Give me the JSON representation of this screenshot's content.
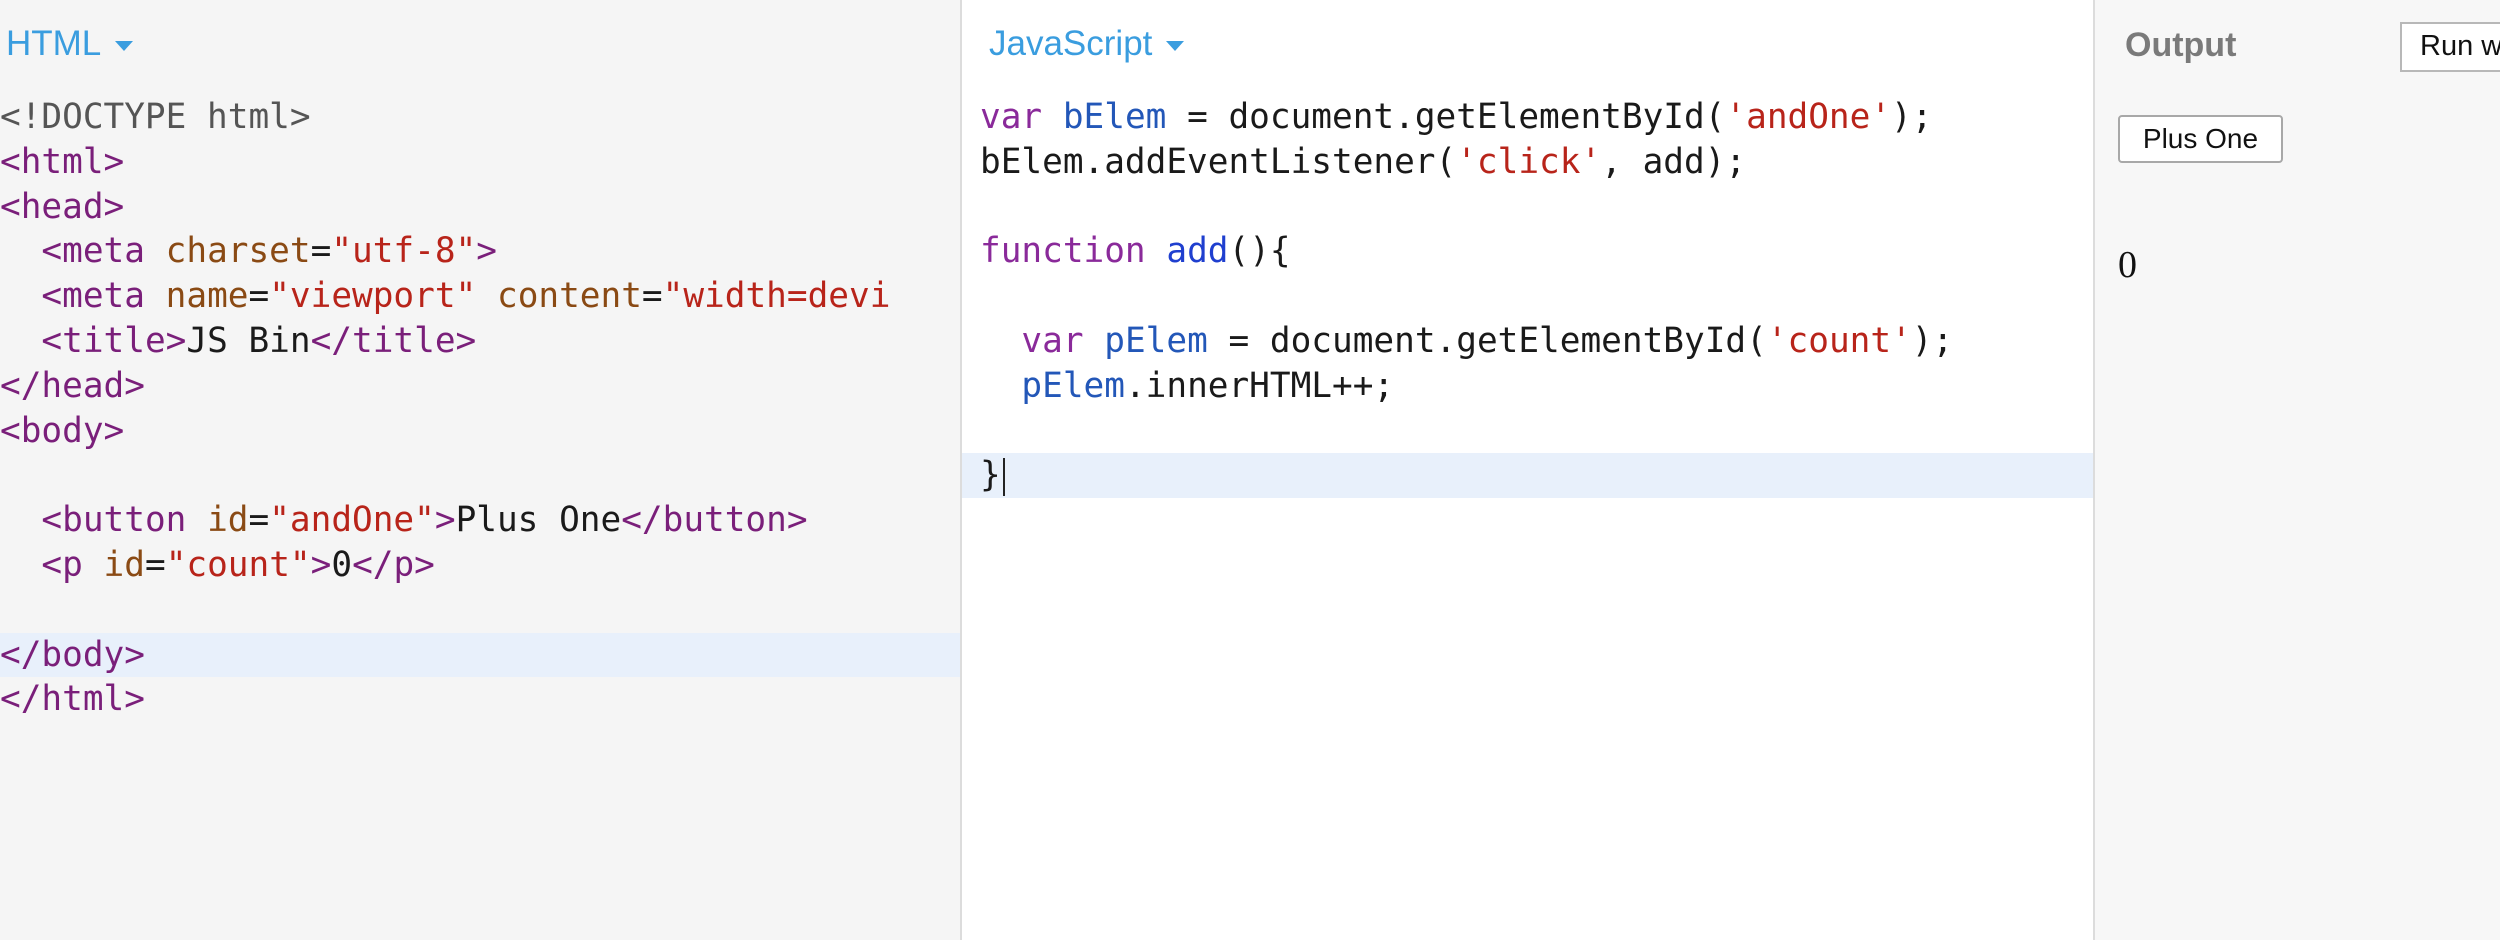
{
  "html_panel": {
    "label": "HTML",
    "lines": [
      [
        {
          "t": "doctype",
          "v": "<!DOCTYPE html>"
        }
      ],
      [
        {
          "t": "tag",
          "v": "<html>"
        }
      ],
      [
        {
          "t": "tag",
          "v": "<head>"
        }
      ],
      [
        {
          "t": "text",
          "v": "  "
        },
        {
          "t": "tag",
          "v": "<meta "
        },
        {
          "t": "attr",
          "v": "charset"
        },
        {
          "t": "text",
          "v": "="
        },
        {
          "t": "str",
          "v": "\"utf-8\""
        },
        {
          "t": "tag",
          "v": ">"
        }
      ],
      [
        {
          "t": "text",
          "v": "  "
        },
        {
          "t": "tag",
          "v": "<meta "
        },
        {
          "t": "attr",
          "v": "name"
        },
        {
          "t": "text",
          "v": "="
        },
        {
          "t": "str",
          "v": "\"viewport\""
        },
        {
          "t": "text",
          "v": " "
        },
        {
          "t": "attr",
          "v": "content"
        },
        {
          "t": "text",
          "v": "="
        },
        {
          "t": "str",
          "v": "\"width=devi"
        }
      ],
      [
        {
          "t": "text",
          "v": "  "
        },
        {
          "t": "tag",
          "v": "<title>"
        },
        {
          "t": "text",
          "v": "JS Bin"
        },
        {
          "t": "tag",
          "v": "</title>"
        }
      ],
      [
        {
          "t": "tag",
          "v": "</head>"
        }
      ],
      [
        {
          "t": "tag",
          "v": "<body>"
        }
      ],
      [],
      [
        {
          "t": "text",
          "v": "  "
        },
        {
          "t": "tag",
          "v": "<button "
        },
        {
          "t": "attr",
          "v": "id"
        },
        {
          "t": "text",
          "v": "="
        },
        {
          "t": "str",
          "v": "\"andOne\""
        },
        {
          "t": "tag",
          "v": ">"
        },
        {
          "t": "text",
          "v": "Plus One"
        },
        {
          "t": "tag",
          "v": "</button>"
        }
      ],
      [
        {
          "t": "text",
          "v": "  "
        },
        {
          "t": "tag",
          "v": "<p "
        },
        {
          "t": "attr",
          "v": "id"
        },
        {
          "t": "text",
          "v": "="
        },
        {
          "t": "str",
          "v": "\"count\""
        },
        {
          "t": "tag",
          "v": ">"
        },
        {
          "t": "text",
          "v": "0"
        },
        {
          "t": "tag",
          "v": "</p>"
        }
      ],
      [],
      [
        {
          "t": "tag",
          "v": "</body>"
        }
      ],
      [
        {
          "t": "tag",
          "v": "</html>"
        }
      ]
    ],
    "active_line": 12
  },
  "js_panel": {
    "label": "JavaScript",
    "lines": [
      [
        {
          "t": "kw",
          "v": "var "
        },
        {
          "t": "var",
          "v": "bElem"
        },
        {
          "t": "plain",
          "v": " = document.getElementById("
        },
        {
          "t": "str",
          "v": "'andOne'"
        },
        {
          "t": "plain",
          "v": ");"
        }
      ],
      [
        {
          "t": "plain",
          "v": "bElem.addEventListener("
        },
        {
          "t": "str",
          "v": "'click'"
        },
        {
          "t": "plain",
          "v": ", add);"
        }
      ],
      [],
      [
        {
          "t": "kw",
          "v": "function "
        },
        {
          "t": "def",
          "v": "add"
        },
        {
          "t": "plain",
          "v": "(){"
        }
      ],
      [],
      [
        {
          "t": "plain",
          "v": "  "
        },
        {
          "t": "kw",
          "v": "var "
        },
        {
          "t": "var",
          "v": "pElem"
        },
        {
          "t": "plain",
          "v": " = document.getElementById("
        },
        {
          "t": "str",
          "v": "'count'"
        },
        {
          "t": "plain",
          "v": ");"
        }
      ],
      [
        {
          "t": "plain",
          "v": "  "
        },
        {
          "t": "var",
          "v": "pElem"
        },
        {
          "t": "plain",
          "v": ".innerHTML++;"
        }
      ],
      [],
      [
        {
          "t": "plain",
          "v": "}"
        }
      ]
    ],
    "active_line": 8
  },
  "output_panel": {
    "title": "Output",
    "run_button": "Run w",
    "plus_button": "Plus One",
    "count": "0"
  }
}
